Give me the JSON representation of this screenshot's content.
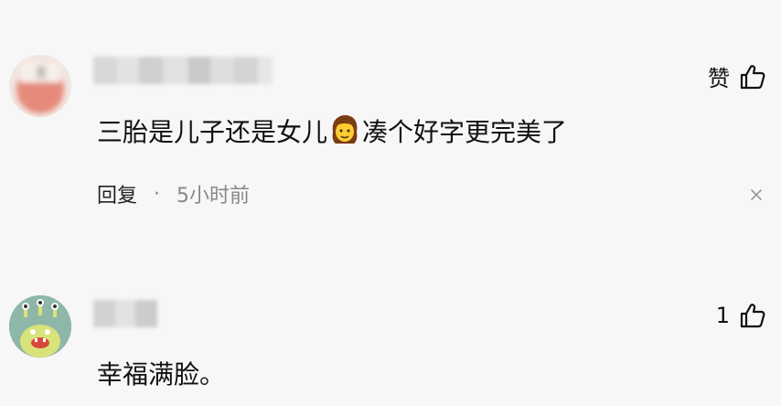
{
  "comments": [
    {
      "like_label": "赞",
      "text_before_emoji": "三胎是儿子还是女儿",
      "emoji": "girl-emoji",
      "text_after_emoji": "凑个好字更完美了",
      "reply_label": "回复",
      "separator": "·",
      "time": "5小时前",
      "close_icon": "close-icon"
    },
    {
      "like_count": "1",
      "text": "幸福满脸。"
    }
  ],
  "colors": {
    "background": "#f7f7f8",
    "text": "#111111",
    "meta": "#888888"
  }
}
